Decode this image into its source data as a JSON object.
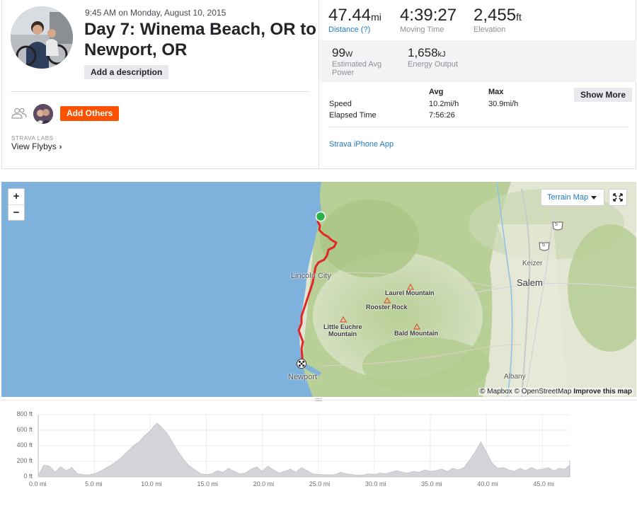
{
  "activity": {
    "date_line": "9:45 AM on Monday, August 10, 2015",
    "title": "Day 7: Winema Beach, OR to Newport, OR",
    "add_description": "Add a description",
    "add_others": "Add Others",
    "labs_label": "STRAVA LABS",
    "view_flybys": "View Flybys"
  },
  "stats": {
    "distance": {
      "value": "47.44",
      "unit": "mi",
      "label": "Distance (?)"
    },
    "moving_time": {
      "value": "4:39:27",
      "label": "Moving Time"
    },
    "elevation": {
      "value": "2,455",
      "unit": "ft",
      "label": "Elevation"
    },
    "power": {
      "value": "99",
      "unit": "W",
      "label": "Estimated Avg Power"
    },
    "energy": {
      "value": "1,658",
      "unit": "kJ",
      "label": "Energy Output"
    },
    "table": {
      "col_avg": "Avg",
      "col_max": "Max",
      "rows": [
        {
          "label": "Speed",
          "avg": "10.2mi/h",
          "max": "30.9mi/h"
        },
        {
          "label": "Elapsed Time",
          "avg": "7:56:26",
          "max": ""
        }
      ]
    },
    "show_more": "Show More",
    "app_link": "Strava iPhone App"
  },
  "map": {
    "zoom_in": "+",
    "zoom_out": "−",
    "map_type": "Terrain Map",
    "attribution_a": "© Mapbox © OpenStreetMap",
    "attribution_b": "Improve this map",
    "labels": {
      "lincoln_city": "Lincoln City",
      "newport": "Newport",
      "laurel_mountain": "Laurel Mountain",
      "rooster_rock": "Rooster Rock",
      "little_euchre_1": "Little Euchre",
      "little_euchre_2": "Mountain",
      "bald_mountain": "Bald Mountain",
      "keizer": "Keizer",
      "salem": "Salem",
      "albany": "Albany",
      "hwy_5a": "5",
      "hwy_5b": "5"
    },
    "colors": {
      "water": "#7fb1dd",
      "route": "#e02626",
      "start": "#2bb24c"
    }
  },
  "elevation_chart": {
    "y_ticks": [
      "800 ft",
      "600 ft",
      "400 ft",
      "200 ft",
      "0 ft"
    ],
    "x_ticks": [
      "0.0 mi",
      "5.0 mi",
      "10.0 mi",
      "15.0 mi",
      "20.0 mi",
      "25.0 mi",
      "30.0 mi",
      "35.0 mi",
      "40.0 mi",
      "45.0 mi"
    ]
  },
  "chart_data": {
    "type": "area",
    "xlabel": "",
    "ylabel": "",
    "ylim": [
      0,
      800
    ],
    "xlim": [
      0,
      47.44
    ],
    "x": [
      0,
      0.5,
      1,
      1.5,
      2,
      2.5,
      3,
      3.5,
      4,
      4.5,
      5,
      5.5,
      6,
      6.5,
      7,
      7.5,
      8,
      8.5,
      9,
      9.5,
      10,
      10.3,
      10.6,
      11,
      11.5,
      12,
      12.5,
      13,
      13.5,
      14,
      14.5,
      15,
      15.5,
      16,
      16.5,
      17,
      17.5,
      18,
      18.5,
      19,
      19.5,
      20,
      20.5,
      21,
      21.5,
      22,
      22.5,
      23,
      23.5,
      24,
      24.5,
      25,
      25.5,
      26,
      26.5,
      27,
      27.5,
      28,
      28.5,
      29,
      29.5,
      30,
      30.5,
      31,
      31.5,
      32,
      32.5,
      33,
      33.5,
      34,
      34.5,
      35,
      35.5,
      36,
      36.5,
      37,
      37.5,
      38,
      38.5,
      39,
      39.5,
      40,
      40.5,
      41,
      41.5,
      42,
      42.5,
      43,
      43.5,
      44,
      44.5,
      45,
      45.5,
      46,
      46.5,
      47,
      47.44
    ],
    "series": [
      {
        "values": [
          20,
          150,
          140,
          60,
          130,
          80,
          120,
          40,
          30,
          25,
          40,
          70,
          110,
          150,
          200,
          260,
          330,
          400,
          450,
          530,
          590,
          650,
          690,
          640,
          560,
          440,
          320,
          220,
          140,
          90,
          40,
          30,
          40,
          80,
          60,
          110,
          70,
          40,
          50,
          100,
          130,
          70,
          140,
          90,
          50,
          70,
          100,
          60,
          120,
          80,
          40,
          30,
          30,
          25,
          30,
          60,
          40,
          30,
          20,
          25,
          40,
          30,
          50,
          40,
          60,
          80,
          60,
          50,
          70,
          60,
          90,
          70,
          80,
          100,
          70,
          110,
          90,
          120,
          220,
          320,
          450,
          320,
          180,
          110,
          120,
          90,
          70,
          110,
          80,
          120,
          90,
          100,
          120,
          80,
          110,
          100,
          150,
          210
        ]
      }
    ]
  }
}
